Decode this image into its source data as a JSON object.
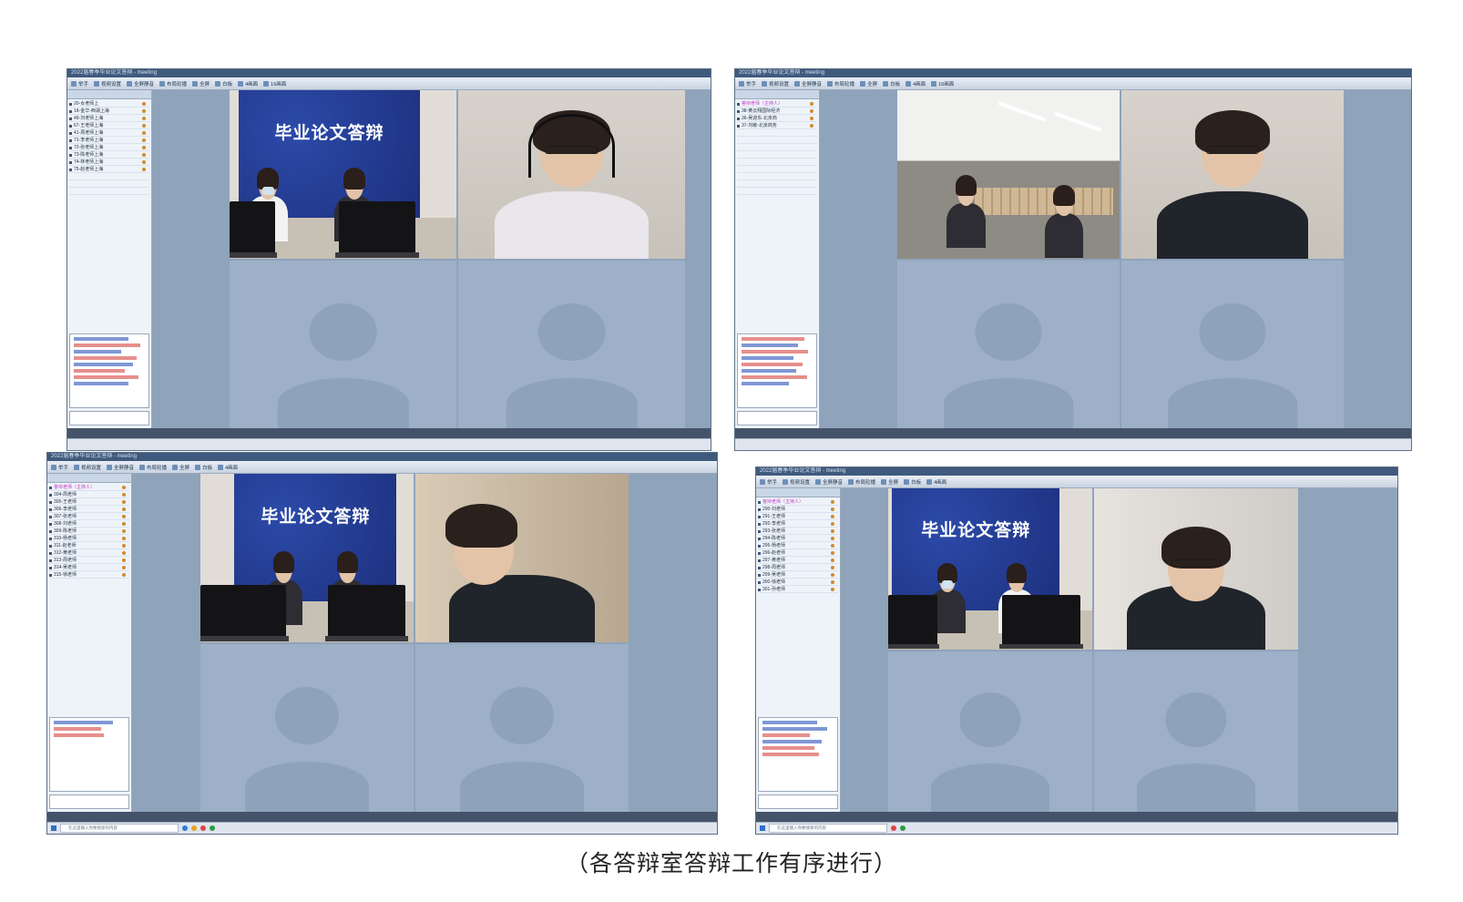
{
  "caption": "（各答辩室答辩工作有序进行）",
  "banner": {
    "title": "毕业论文答辩"
  },
  "screenshots": [
    {
      "window_title": "2022届春季毕业论文答辩 - meeting",
      "toolbar": [
        "举手",
        "视频设置",
        "全屏静音",
        "布局轮播",
        "全屏",
        "白板",
        "4画面",
        "16画面"
      ],
      "users": [
        "20-女老师上",
        "18-金华-西湖上海",
        "49-刘老师上海",
        "67-王老师上海",
        "41-周老师上海",
        "71-李老师上海",
        "72-张老师上海",
        "73-陈老师上海",
        "74-林老师上海",
        "75-赵老师上海"
      ],
      "chat_search_placeholder": "在这里输入你要搜索的内容"
    },
    {
      "window_title": "2022届春季毕业论文答辩 - meeting",
      "toolbar": [
        "举手",
        "视频设置",
        "全屏静音",
        "布局轮播",
        "全屏",
        "白板",
        "4画面",
        "16画面"
      ],
      "users": [
        "答辩老师（主持人）",
        "38-黄云翔国际经济",
        "36-吴迎东-北京商",
        "37-刘敏-北京商务"
      ],
      "chat_search_placeholder": ""
    },
    {
      "window_title": "2022届春季毕业论文答辩 - meeting",
      "toolbar": [
        "举手",
        "视频设置",
        "全屏静音",
        "布局轮播",
        "全屏",
        "白板",
        "4画面"
      ],
      "users": [
        "答辩老师（主持人）",
        "304-周老师",
        "305-王老师",
        "306-李老师",
        "307-张老师",
        "308-刘老师",
        "309-陈老师",
        "310-杨老师",
        "311-赵老师",
        "312-黄老师",
        "313-周老师",
        "314-吴老师",
        "315-徐老师",
        "316-孙老师"
      ],
      "chat_search_placeholder": "在这里输入你要搜索的内容"
    },
    {
      "window_title": "2022届春季毕业论文答辩 - meeting",
      "toolbar": [
        "举手",
        "视频设置",
        "全屏静音",
        "布局轮播",
        "全屏",
        "白板",
        "4画面"
      ],
      "users": [
        "答辩老师（主持人）",
        "290-刘老师",
        "291-王老师",
        "292-李老师",
        "293-张老师",
        "294-陈老师",
        "295-杨老师",
        "296-赵老师",
        "297-黄老师",
        "298-周老师",
        "299-吴老师",
        "300-徐老师",
        "301-孙老师"
      ],
      "chat_search_placeholder": "在这里输入你要搜索的内容"
    }
  ]
}
